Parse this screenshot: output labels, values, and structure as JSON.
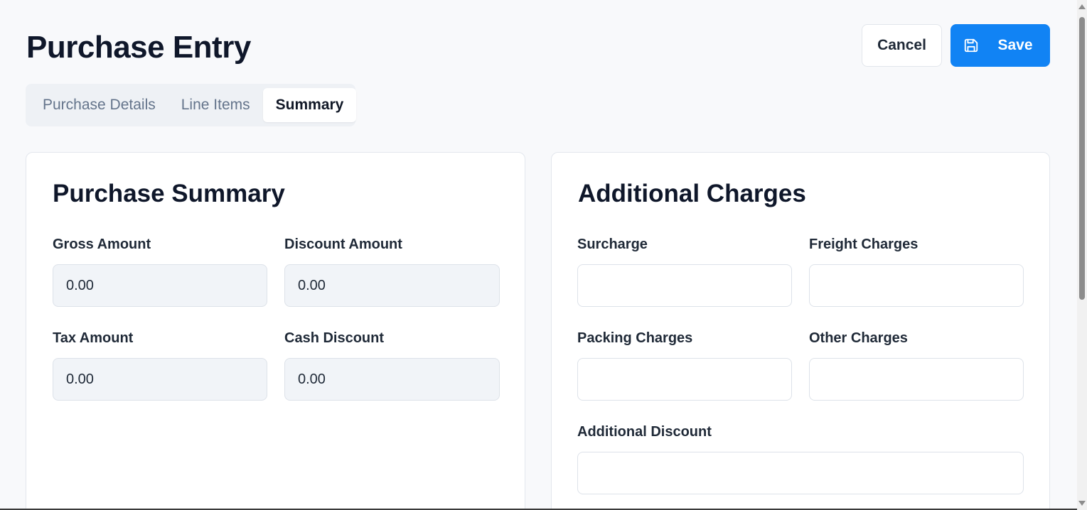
{
  "page": {
    "title": "Purchase Entry"
  },
  "actions": {
    "cancel_label": "Cancel",
    "save_label": "Save",
    "save_icon": "floppy-disk-icon"
  },
  "tabs": [
    {
      "label": "Purchase Details",
      "active": false
    },
    {
      "label": "Line Items",
      "active": false
    },
    {
      "label": "Summary",
      "active": true
    }
  ],
  "purchase_summary": {
    "title": "Purchase Summary",
    "fields": [
      {
        "label": "Gross Amount",
        "value": "0.00",
        "readonly": true
      },
      {
        "label": "Discount Amount",
        "value": "0.00",
        "readonly": true
      },
      {
        "label": "Tax Amount",
        "value": "0.00",
        "readonly": true
      },
      {
        "label": "Cash Discount",
        "value": "0.00",
        "readonly": true
      }
    ]
  },
  "additional_charges": {
    "title": "Additional Charges",
    "fields": [
      {
        "label": "Surcharge",
        "value": ""
      },
      {
        "label": "Freight Charges",
        "value": ""
      },
      {
        "label": "Packing Charges",
        "value": ""
      },
      {
        "label": "Other Charges",
        "value": ""
      },
      {
        "label": "Additional Discount",
        "value": ""
      }
    ]
  },
  "colors": {
    "accent": "#1183f4",
    "background": "#f8f9fb",
    "readonly_field": "#f1f4f8"
  }
}
